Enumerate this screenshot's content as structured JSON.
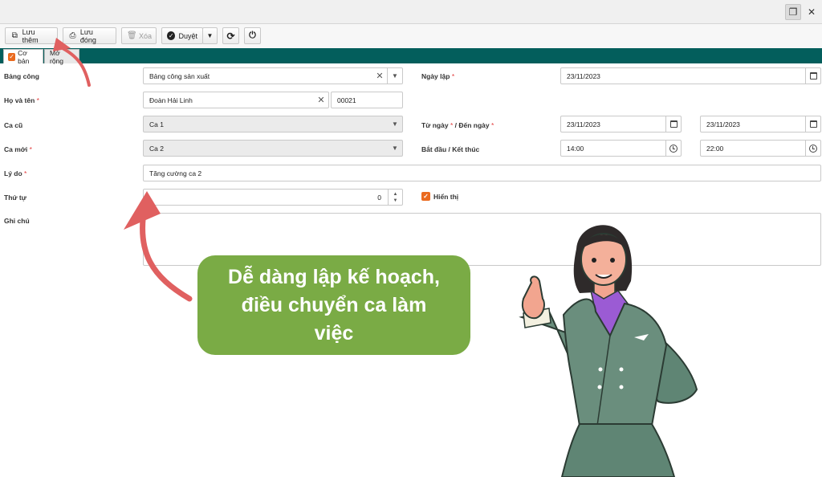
{
  "toolbar": {
    "save_new": "Lưu thêm",
    "save_close": "Lưu đóng",
    "delete": "Xóa",
    "approve": "Duyệt"
  },
  "tabs": [
    {
      "label": "Cơ bản",
      "active": true
    },
    {
      "label": "Mở rộng",
      "active": false
    }
  ],
  "form": {
    "bang_cong": {
      "label": "Bảng công",
      "value": "Bảng công sản xuất"
    },
    "ngay_lap": {
      "label": "Ngày lập",
      "value": "23/11/2023"
    },
    "ho_va_ten": {
      "label": "Họ và tên",
      "value": "Đoàn Hải Linh",
      "code": "00021"
    },
    "ca_cu": {
      "label": "Ca cũ",
      "value": "Ca 1"
    },
    "tu_ngay_den_ngay": {
      "label_from": "Từ ngày",
      "label_to": "Đến ngày",
      "from": "23/11/2023",
      "to": "23/11/2023"
    },
    "ca_moi": {
      "label": "Ca mới",
      "value": "Ca 2"
    },
    "bat_dau_ket_thuc": {
      "label": "Bắt đầu / Kết thúc",
      "start": "14:00",
      "end": "22:00"
    },
    "ly_do": {
      "label": "Lý do",
      "value": "Tăng cường ca 2"
    },
    "thu_tu": {
      "label": "Thứ tự",
      "value": "0"
    },
    "hien_thi": {
      "label": "Hiển thị",
      "checked": true
    },
    "ghi_chu": {
      "label": "Ghi chú",
      "value": ""
    }
  },
  "callout": {
    "line1": "Dễ dàng lập kế hoạch,",
    "line2": "điều chuyển ca làm",
    "line3": "việc"
  },
  "colors": {
    "tab_bar": "#035e5c",
    "callout_bg": "#7aab45",
    "arrow": "#e06060",
    "checkbox": "#ea6a1f",
    "required": "#e23b3b"
  }
}
